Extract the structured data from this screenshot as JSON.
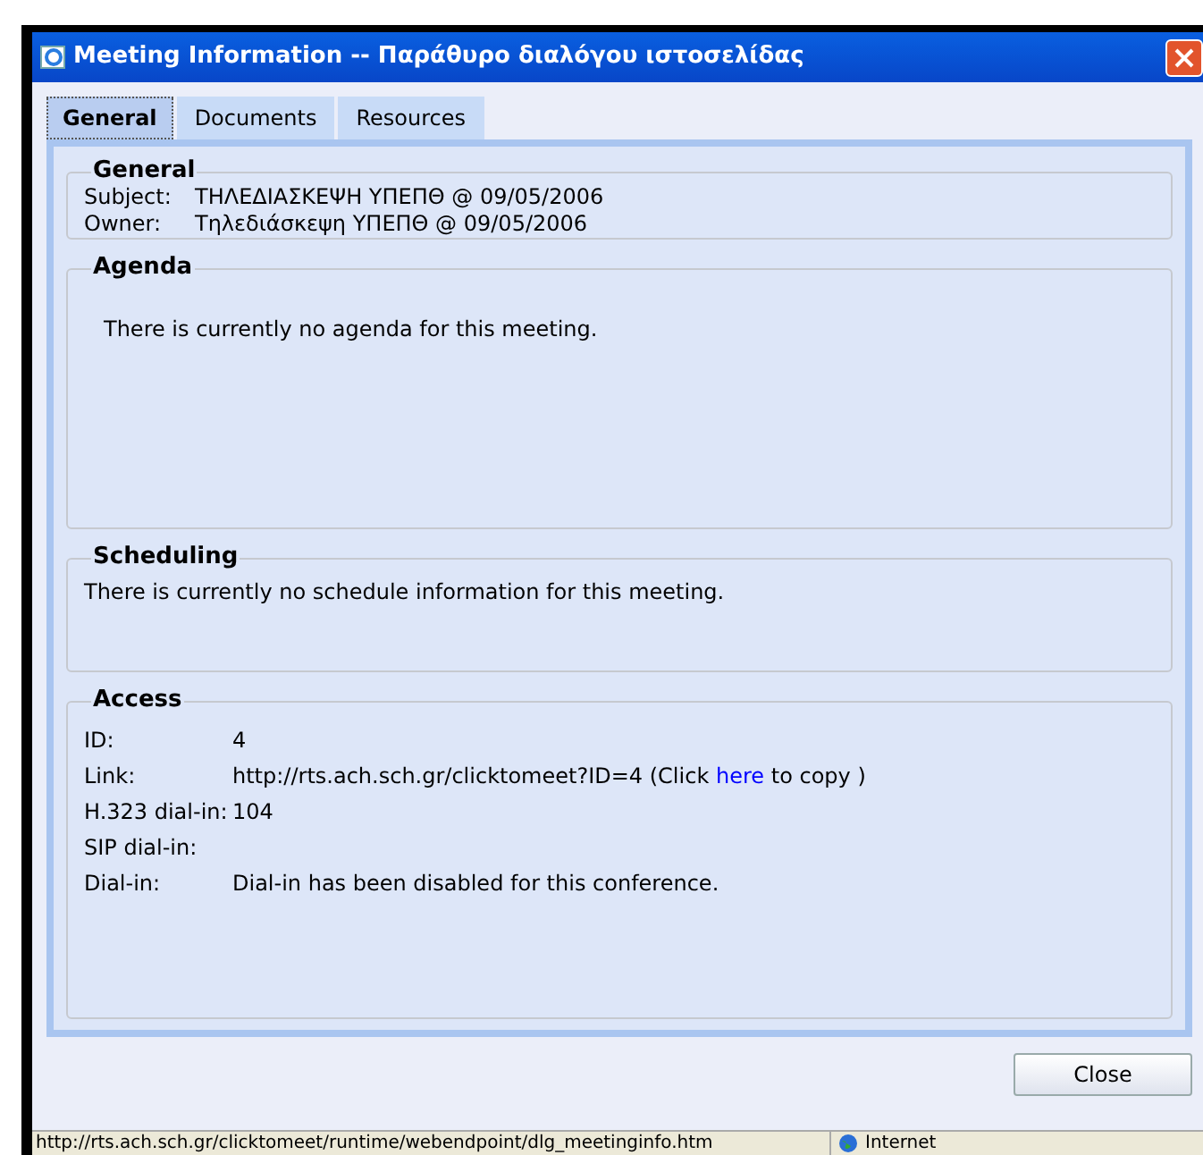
{
  "window": {
    "title": "Meeting Information -- Παράθυρο διαλόγου ιστοσελίδας"
  },
  "tabs": [
    {
      "label": "General",
      "selected": true
    },
    {
      "label": "Documents",
      "selected": false
    },
    {
      "label": "Resources",
      "selected": false
    }
  ],
  "general": {
    "title": "General",
    "rows": [
      {
        "label": "Subject:",
        "value": "ΤΗΛΕΔΙΑΣΚΕΨΗ ΥΠΕΠΘ @ 09/05/2006"
      },
      {
        "label": "Owner:",
        "value": "Τηλεδιάσκεψη ΥΠΕΠΘ @ 09/05/2006"
      }
    ]
  },
  "agenda": {
    "title": "Agenda",
    "text": "There is currently no agenda for this meeting."
  },
  "scheduling": {
    "title": "Scheduling",
    "text": "There is currently no schedule information for this meeting."
  },
  "access": {
    "title": "Access",
    "rows": [
      {
        "label": "ID:",
        "value": "4"
      },
      {
        "label": "Link:",
        "value": "http://rts.ach.sch.gr/clicktomeet?ID=4 (Click",
        "link": "here",
        "after": "to copy )"
      },
      {
        "label": "H.323 dial-in:",
        "value": "104"
      },
      {
        "label": "SIP dial-in:"
      },
      {
        "label": "Dial-in:",
        "value": "Dial-in has been disabled for this conference."
      }
    ]
  },
  "buttons": [
    "Close"
  ],
  "status_bar": {
    "url": "http://rts.ach.sch.gr/clicktomeet/runtime/webendpoint/dlg_meetinginfo.htm",
    "zone": "Internet"
  }
}
